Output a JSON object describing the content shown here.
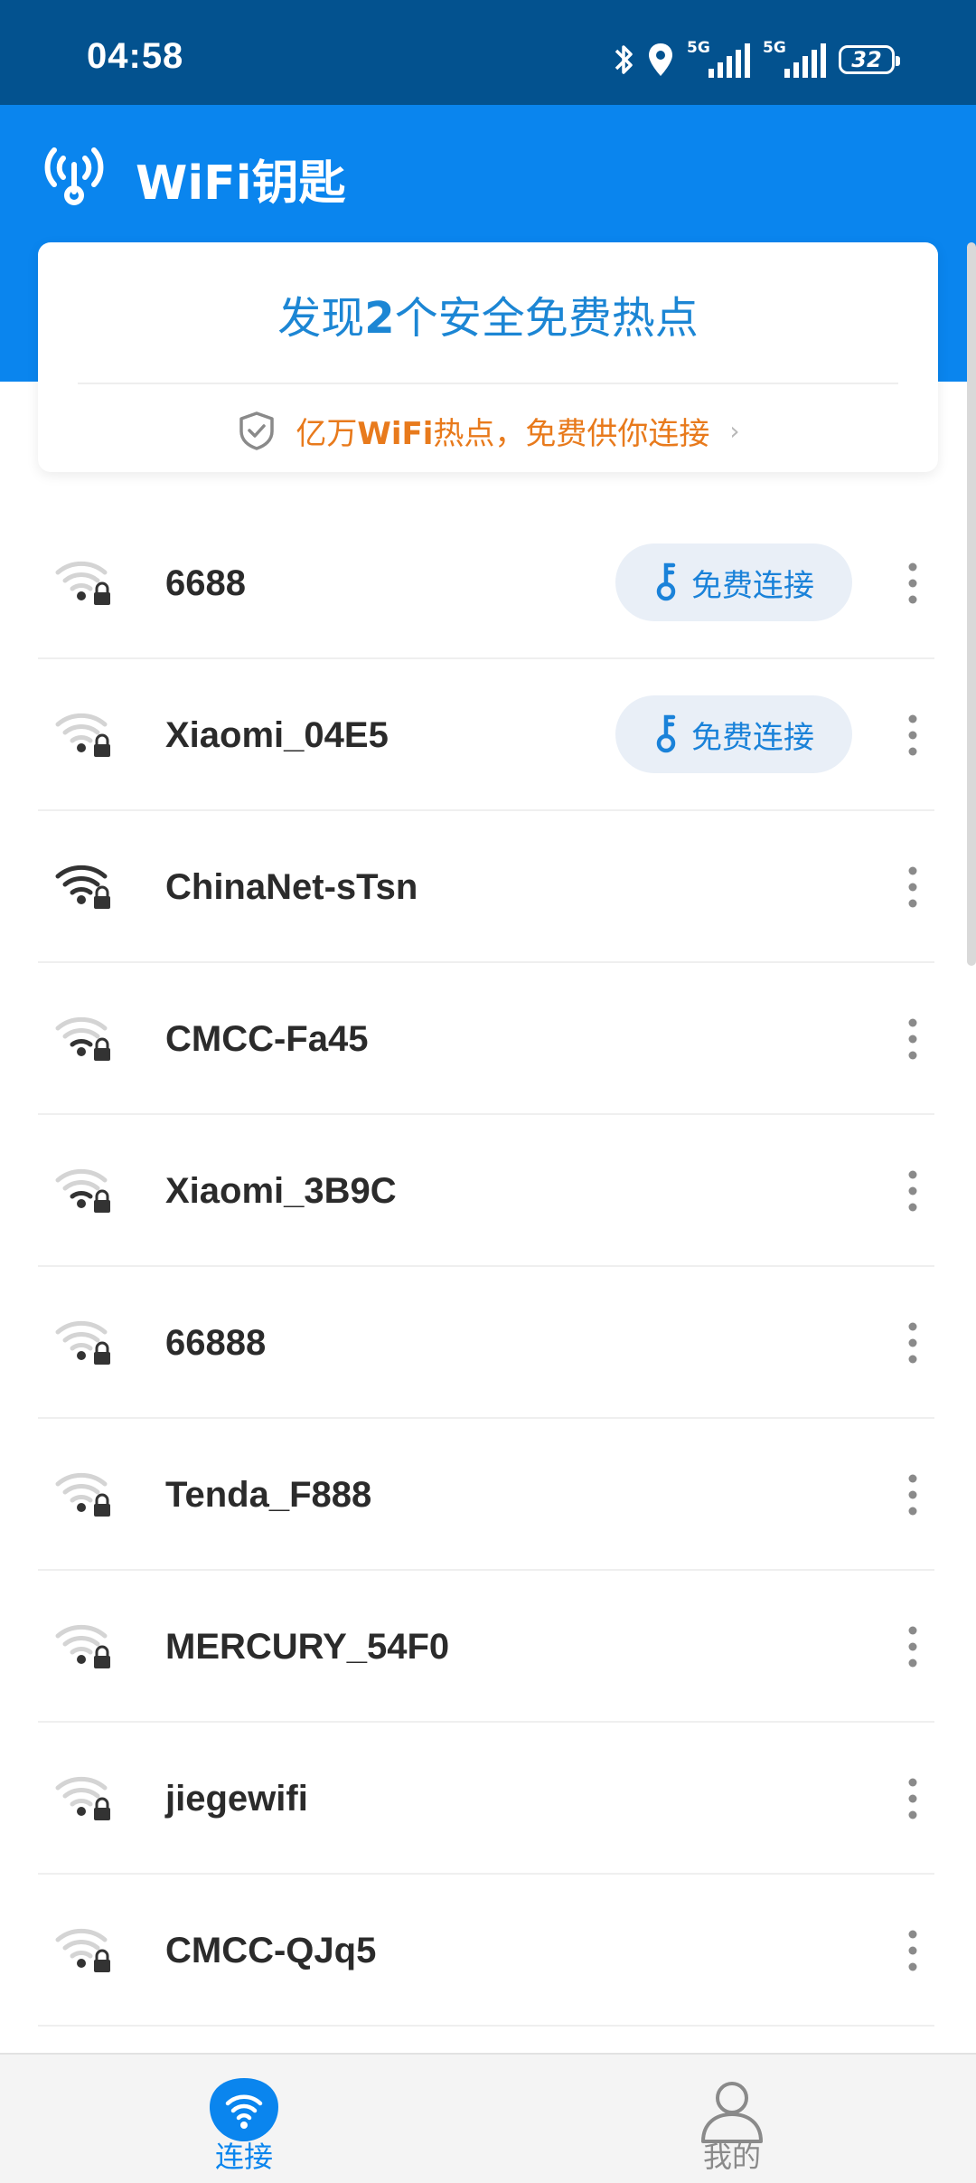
{
  "status_bar": {
    "time": "04:58",
    "network_1": "5G",
    "network_2": "5G",
    "battery_level": "32",
    "icons": [
      "bluetooth-icon",
      "location-icon",
      "signal-icon",
      "signal-icon",
      "battery-icon"
    ]
  },
  "app_bar": {
    "title": "WiFi钥匙",
    "logo_icon": "wifi-signal-tower-icon"
  },
  "found_card": {
    "title_prefix": "发现",
    "count": "2",
    "title_suffix": "个安全免费热点",
    "promo_prefix": "亿万",
    "promo_bold": "WiFi",
    "promo_suffix": "热点，免费供你连接",
    "promo_arrow": "›"
  },
  "networks": [
    {
      "ssid": "6688",
      "button": "免费连接",
      "signal_bars": 1
    },
    {
      "ssid": "Xiaomi_04E5",
      "button": "免费连接",
      "signal_bars": 1
    },
    {
      "ssid": "ChinaNet-sTsn",
      "signal_bars": 4
    },
    {
      "ssid": "CMCC-Fa45",
      "signal_bars": 2
    },
    {
      "ssid": "Xiaomi_3B9C",
      "signal_bars": 2
    },
    {
      "ssid": "66888",
      "signal_bars": 1
    },
    {
      "ssid": "Tenda_F888",
      "signal_bars": 1
    },
    {
      "ssid": "MERCURY_54F0",
      "signal_bars": 1
    },
    {
      "ssid": "jiegewifi",
      "signal_bars": 1
    },
    {
      "ssid": "CMCC-QJq5",
      "signal_bars": 1
    }
  ],
  "bottom_nav": {
    "tabs": [
      {
        "label": "连接",
        "icon": "wifi-icon",
        "active": true
      },
      {
        "label": "我的",
        "icon": "person-icon",
        "active": false
      }
    ]
  },
  "colors": {
    "status_bar": "#03528f",
    "app_bar": "#0a85ee",
    "accent_blue": "#1a82d9",
    "promo_orange": "#e87a1c",
    "button_bg": "#e9eff7"
  }
}
